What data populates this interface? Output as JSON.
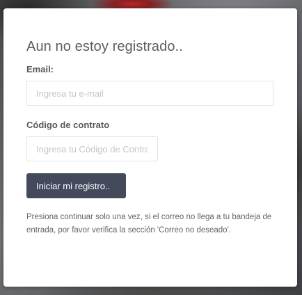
{
  "form": {
    "title": "Aun no estoy registrado..",
    "email_label": "Email:",
    "email_placeholder": "Ingresa tu e-mail",
    "email_value": "",
    "code_label": "Código de contrato",
    "code_placeholder": "Ingresa tu Código de Contrato",
    "code_value": "",
    "submit_label": "Iniciar mi registro..",
    "note": "Presiona continuar solo una vez, si el correo no llega a tu bandeja de entrada, por favor verifica la sección 'Correo no deseado'."
  },
  "colors": {
    "button_bg": "#434a5b",
    "card_bg": "#ffffff",
    "title_text": "#5a5d63"
  }
}
